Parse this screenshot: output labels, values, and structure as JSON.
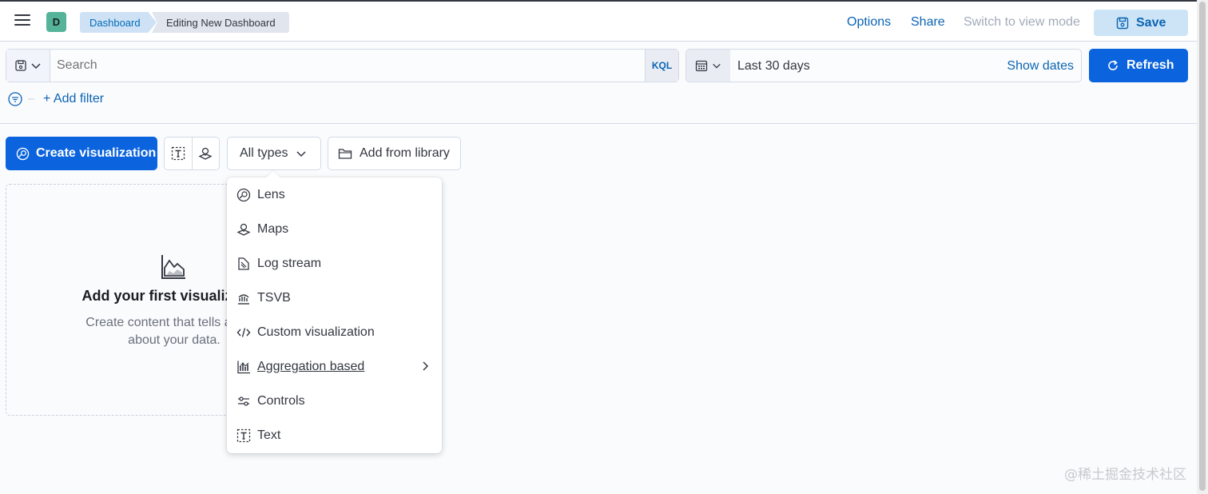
{
  "topbar": {
    "avatar_letter": "D",
    "breadcrumbs": [
      "Dashboard",
      "Editing New Dashboard"
    ],
    "links": {
      "options": "Options",
      "share": "Share",
      "switch_mode": "Switch to view mode"
    },
    "save_label": "Save"
  },
  "query": {
    "placeholder": "Search",
    "language": "KQL",
    "date_range": "Last 30 days",
    "show_dates": "Show dates",
    "refresh_label": "Refresh"
  },
  "filters": {
    "add_filter": "+ Add filter"
  },
  "toolbar": {
    "create_label": "Create visualization",
    "types_label": "All types",
    "library_label": "Add from library"
  },
  "empty_state": {
    "title": "Add your first visualization",
    "desc_line1": "Create content that tells a story",
    "desc_line2": "about your data."
  },
  "menu": {
    "items": [
      {
        "label": "Lens",
        "icon": "lens-icon"
      },
      {
        "label": "Maps",
        "icon": "maps-icon"
      },
      {
        "label": "Log stream",
        "icon": "log-stream-icon"
      },
      {
        "label": "TSVB",
        "icon": "tsvb-icon"
      },
      {
        "label": "Custom visualization",
        "icon": "code-icon"
      },
      {
        "label": "Aggregation based",
        "icon": "aggregation-icon"
      },
      {
        "label": "Controls",
        "icon": "controls-icon"
      },
      {
        "label": "Text",
        "icon": "text-icon"
      }
    ]
  },
  "watermark": "@稀土掘金技术社区",
  "colors": {
    "primary": "#0b64dd",
    "link": "#0b64b4",
    "avatar": "#54b399"
  }
}
